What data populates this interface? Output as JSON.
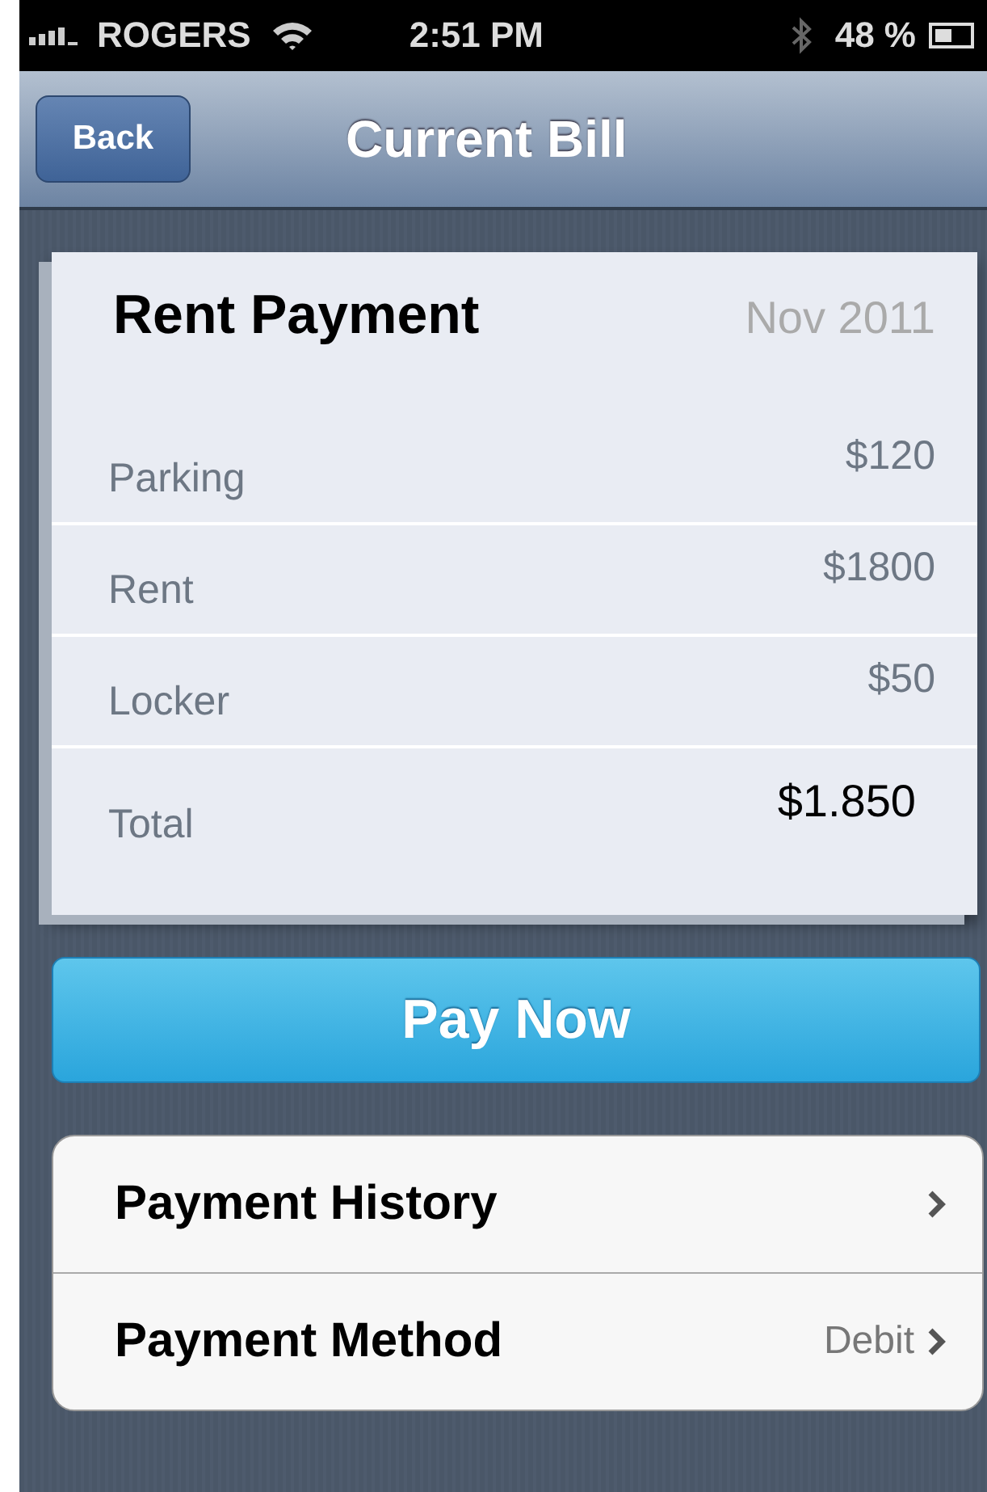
{
  "status_bar": {
    "carrier": "ROGERS",
    "time": "2:51 PM",
    "battery": "48 %"
  },
  "nav_bar": {
    "back": "Back",
    "title": "Current Bill"
  },
  "bill": {
    "title": "Rent Payment",
    "period": "Nov 2011",
    "lines": [
      {
        "kind": "item",
        "label": "Parking",
        "amount": "$120"
      },
      {
        "kind": "item",
        "label": "Rent",
        "amount": "$1800"
      },
      {
        "kind": "item",
        "label": "Locker",
        "amount": "$50"
      },
      {
        "kind": "total",
        "label": "Total",
        "amount": "$1.850"
      }
    ]
  },
  "pay_button": "Pay Now",
  "menu": [
    {
      "label": "Payment History"
    },
    {
      "label": "Payment Method",
      "value": "Debit"
    }
  ]
}
